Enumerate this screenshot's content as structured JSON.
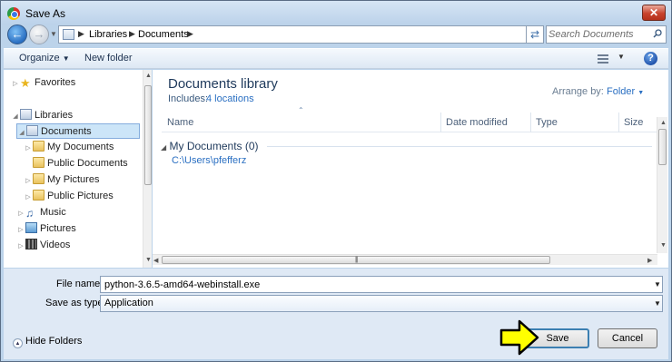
{
  "window": {
    "title": "Save As",
    "close_label": "✕"
  },
  "navigation": {
    "breadcrumbs": [
      "Libraries",
      "Documents"
    ],
    "search_placeholder": "Search Documents"
  },
  "toolbar": {
    "organize_label": "Organize",
    "new_folder_label": "New folder",
    "help_label": "?"
  },
  "sidebar": {
    "items": [
      {
        "label": "Favorites",
        "icon": "star-icon"
      },
      {
        "label": "Libraries",
        "icon": "library-icon"
      },
      {
        "label": "Documents",
        "icon": "documents-library-icon",
        "selected": true
      },
      {
        "label": "My Documents",
        "icon": "folder-icon"
      },
      {
        "label": "Public Documents",
        "icon": "folder-icon"
      },
      {
        "label": "My Pictures",
        "icon": "folder-icon"
      },
      {
        "label": "Public Pictures",
        "icon": "folder-icon"
      },
      {
        "label": "Music",
        "icon": "music-icon"
      },
      {
        "label": "Pictures",
        "icon": "pictures-icon"
      },
      {
        "label": "Videos",
        "icon": "videos-icon"
      }
    ]
  },
  "content": {
    "library_title": "Documents library",
    "includes_label": "Includes:",
    "locations_link": "4 locations",
    "arrange_label": "Arrange by:",
    "arrange_value": "Folder",
    "columns": [
      "Name",
      "Date modified",
      "Type",
      "Size"
    ],
    "group_title": "My Documents (0)",
    "group_path": "C:\\Users\\pfefferz"
  },
  "form": {
    "filename_label": "File name:",
    "filename_value": "python-3.6.5-amd64-webinstall.exe",
    "savetype_label": "Save as type:",
    "savetype_value": "Application"
  },
  "footer": {
    "hide_folders_label": "Hide Folders",
    "save_label": "Save",
    "cancel_label": "Cancel"
  },
  "colors": {
    "arrow_fill": "#ffff00",
    "link": "#2a6fc2",
    "selection": "#cce5f8"
  }
}
